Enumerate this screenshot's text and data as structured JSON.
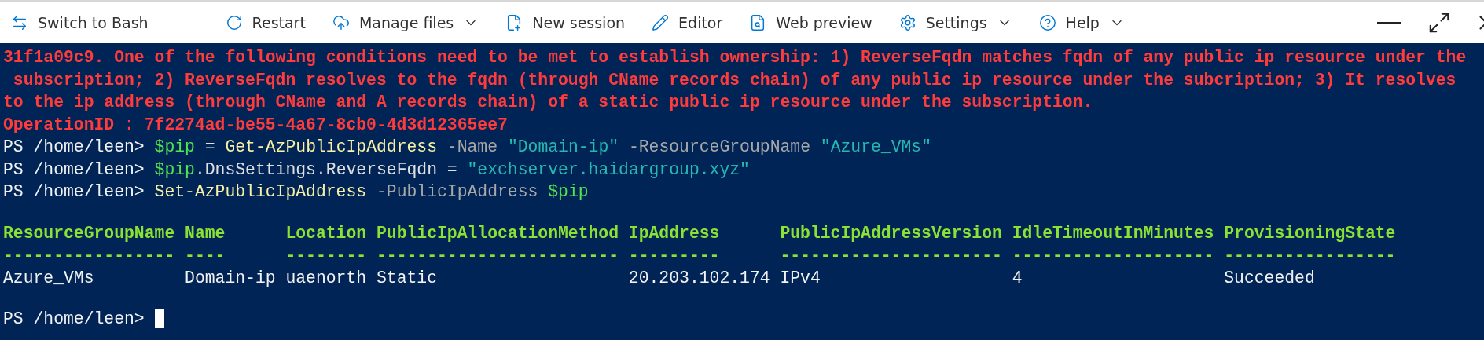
{
  "toolbar": {
    "items": [
      {
        "label": "Switch to Bash",
        "dropdown": false
      },
      {
        "label": "Restart",
        "dropdown": false
      },
      {
        "label": "Manage files",
        "dropdown": true
      },
      {
        "label": "New session",
        "dropdown": false
      },
      {
        "label": "Editor",
        "dropdown": false
      },
      {
        "label": "Web preview",
        "dropdown": false
      },
      {
        "label": "Settings",
        "dropdown": true
      },
      {
        "label": "Help",
        "dropdown": true
      }
    ]
  },
  "terminal": {
    "error_lines": [
      "31f1a09c9. One of the following conditions need to be met to establish ownership: 1) ReverseFqdn matches fqdn of any public ip resource under the",
      " subscription; 2) ReverseFqdn resolves to the fqdn (through CName records chain) of any public ip resource under the subcription; 3) It resolves",
      "to the ip address (through CName and A records chain) of a static public ip resource under the subscription.",
      "OperationID : 7f2274ad-be55-4a67-8cb0-4d3d12365ee7"
    ],
    "commands": [
      [
        {
          "text": "PS /home/leen> ",
          "kind": "prompt"
        },
        {
          "text": "$pip",
          "kind": "variable"
        },
        {
          "text": " = ",
          "kind": "plain"
        },
        {
          "text": "Get-AzPublicIpAddress",
          "kind": "command"
        },
        {
          "text": " -Name ",
          "kind": "parameter"
        },
        {
          "text": "\"Domain-ip\"",
          "kind": "string"
        },
        {
          "text": " -ResourceGroupName ",
          "kind": "parameter"
        },
        {
          "text": "\"Azure_VMs\"",
          "kind": "string"
        }
      ],
      [
        {
          "text": "PS /home/leen> ",
          "kind": "prompt"
        },
        {
          "text": "$pip",
          "kind": "variable"
        },
        {
          "text": ".DnsSettings.ReverseFqdn = ",
          "kind": "plain"
        },
        {
          "text": "\"exchserver.haidargroup.xyz\"",
          "kind": "string"
        }
      ],
      [
        {
          "text": "PS /home/leen> ",
          "kind": "prompt"
        },
        {
          "text": "Set-AzPublicIpAddress",
          "kind": "command"
        },
        {
          "text": " -PublicIpAddress ",
          "kind": "parameter"
        },
        {
          "text": "$pip",
          "kind": "variable"
        }
      ]
    ],
    "table": {
      "columns": [
        {
          "header": "ResourceGroupName",
          "rule": "-----------------",
          "value": "Azure_VMs"
        },
        {
          "header": "Name",
          "rule": "----",
          "value": "Domain-ip"
        },
        {
          "header": "Location",
          "rule": "--------",
          "value": "uaenorth"
        },
        {
          "header": "PublicIpAllocationMethod",
          "rule": "------------------------",
          "value": "Static"
        },
        {
          "header": "IpAddress",
          "rule": "---------",
          "value": "20.203.102.174"
        },
        {
          "header": "PublicIpAddressVersion",
          "rule": "----------------------",
          "value": "IPv4"
        },
        {
          "header": "IdleTimeoutInMinutes",
          "rule": "--------------------",
          "value": "4"
        },
        {
          "header": "ProvisioningState",
          "rule": "-----------------",
          "value": "Succeeded"
        }
      ]
    },
    "prompt": "PS /home/leen> "
  }
}
